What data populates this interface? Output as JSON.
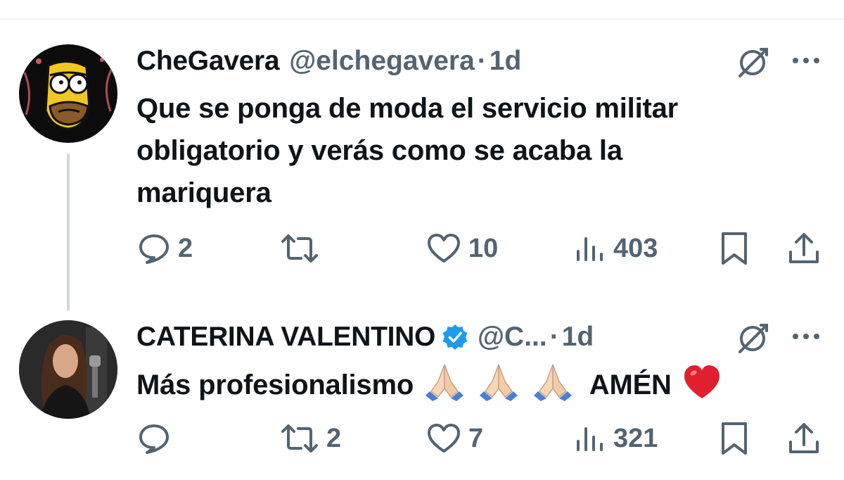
{
  "tweets": [
    {
      "name": "CheGavera",
      "handle": "@elchegavera",
      "dot": "·",
      "time": "1d",
      "verified": false,
      "avatar": "simpson-avatar",
      "text": "Que se ponga de moda el servicio militar obligatorio y verás como se acaba la mariquera",
      "text_lines": [
        "Que se ponga de moda el servicio militar",
        "obligatorio y verás como se acaba la",
        "mariquera"
      ],
      "actions": {
        "replies": "2",
        "reposts": "",
        "likes": "10",
        "views": "403"
      }
    },
    {
      "name": "CATERINA VALENTINO",
      "handle": "@C...",
      "dot": "·",
      "time": "1d",
      "verified": true,
      "avatar": "woman-avatar",
      "text_before": "Más profesionalismo",
      "text_after": "AMÉN",
      "emoji": [
        "folded-hands",
        "folded-hands",
        "folded-hands",
        "red-heart"
      ],
      "actions": {
        "replies": "",
        "reposts": "2",
        "likes": "7",
        "views": "321"
      }
    }
  ],
  "colors": {
    "text": "#0f1419",
    "secondary": "#536471",
    "verified_blue": "#1d9bf0",
    "thread_line": "#cfd9de",
    "heart_red": "#e0202e"
  }
}
